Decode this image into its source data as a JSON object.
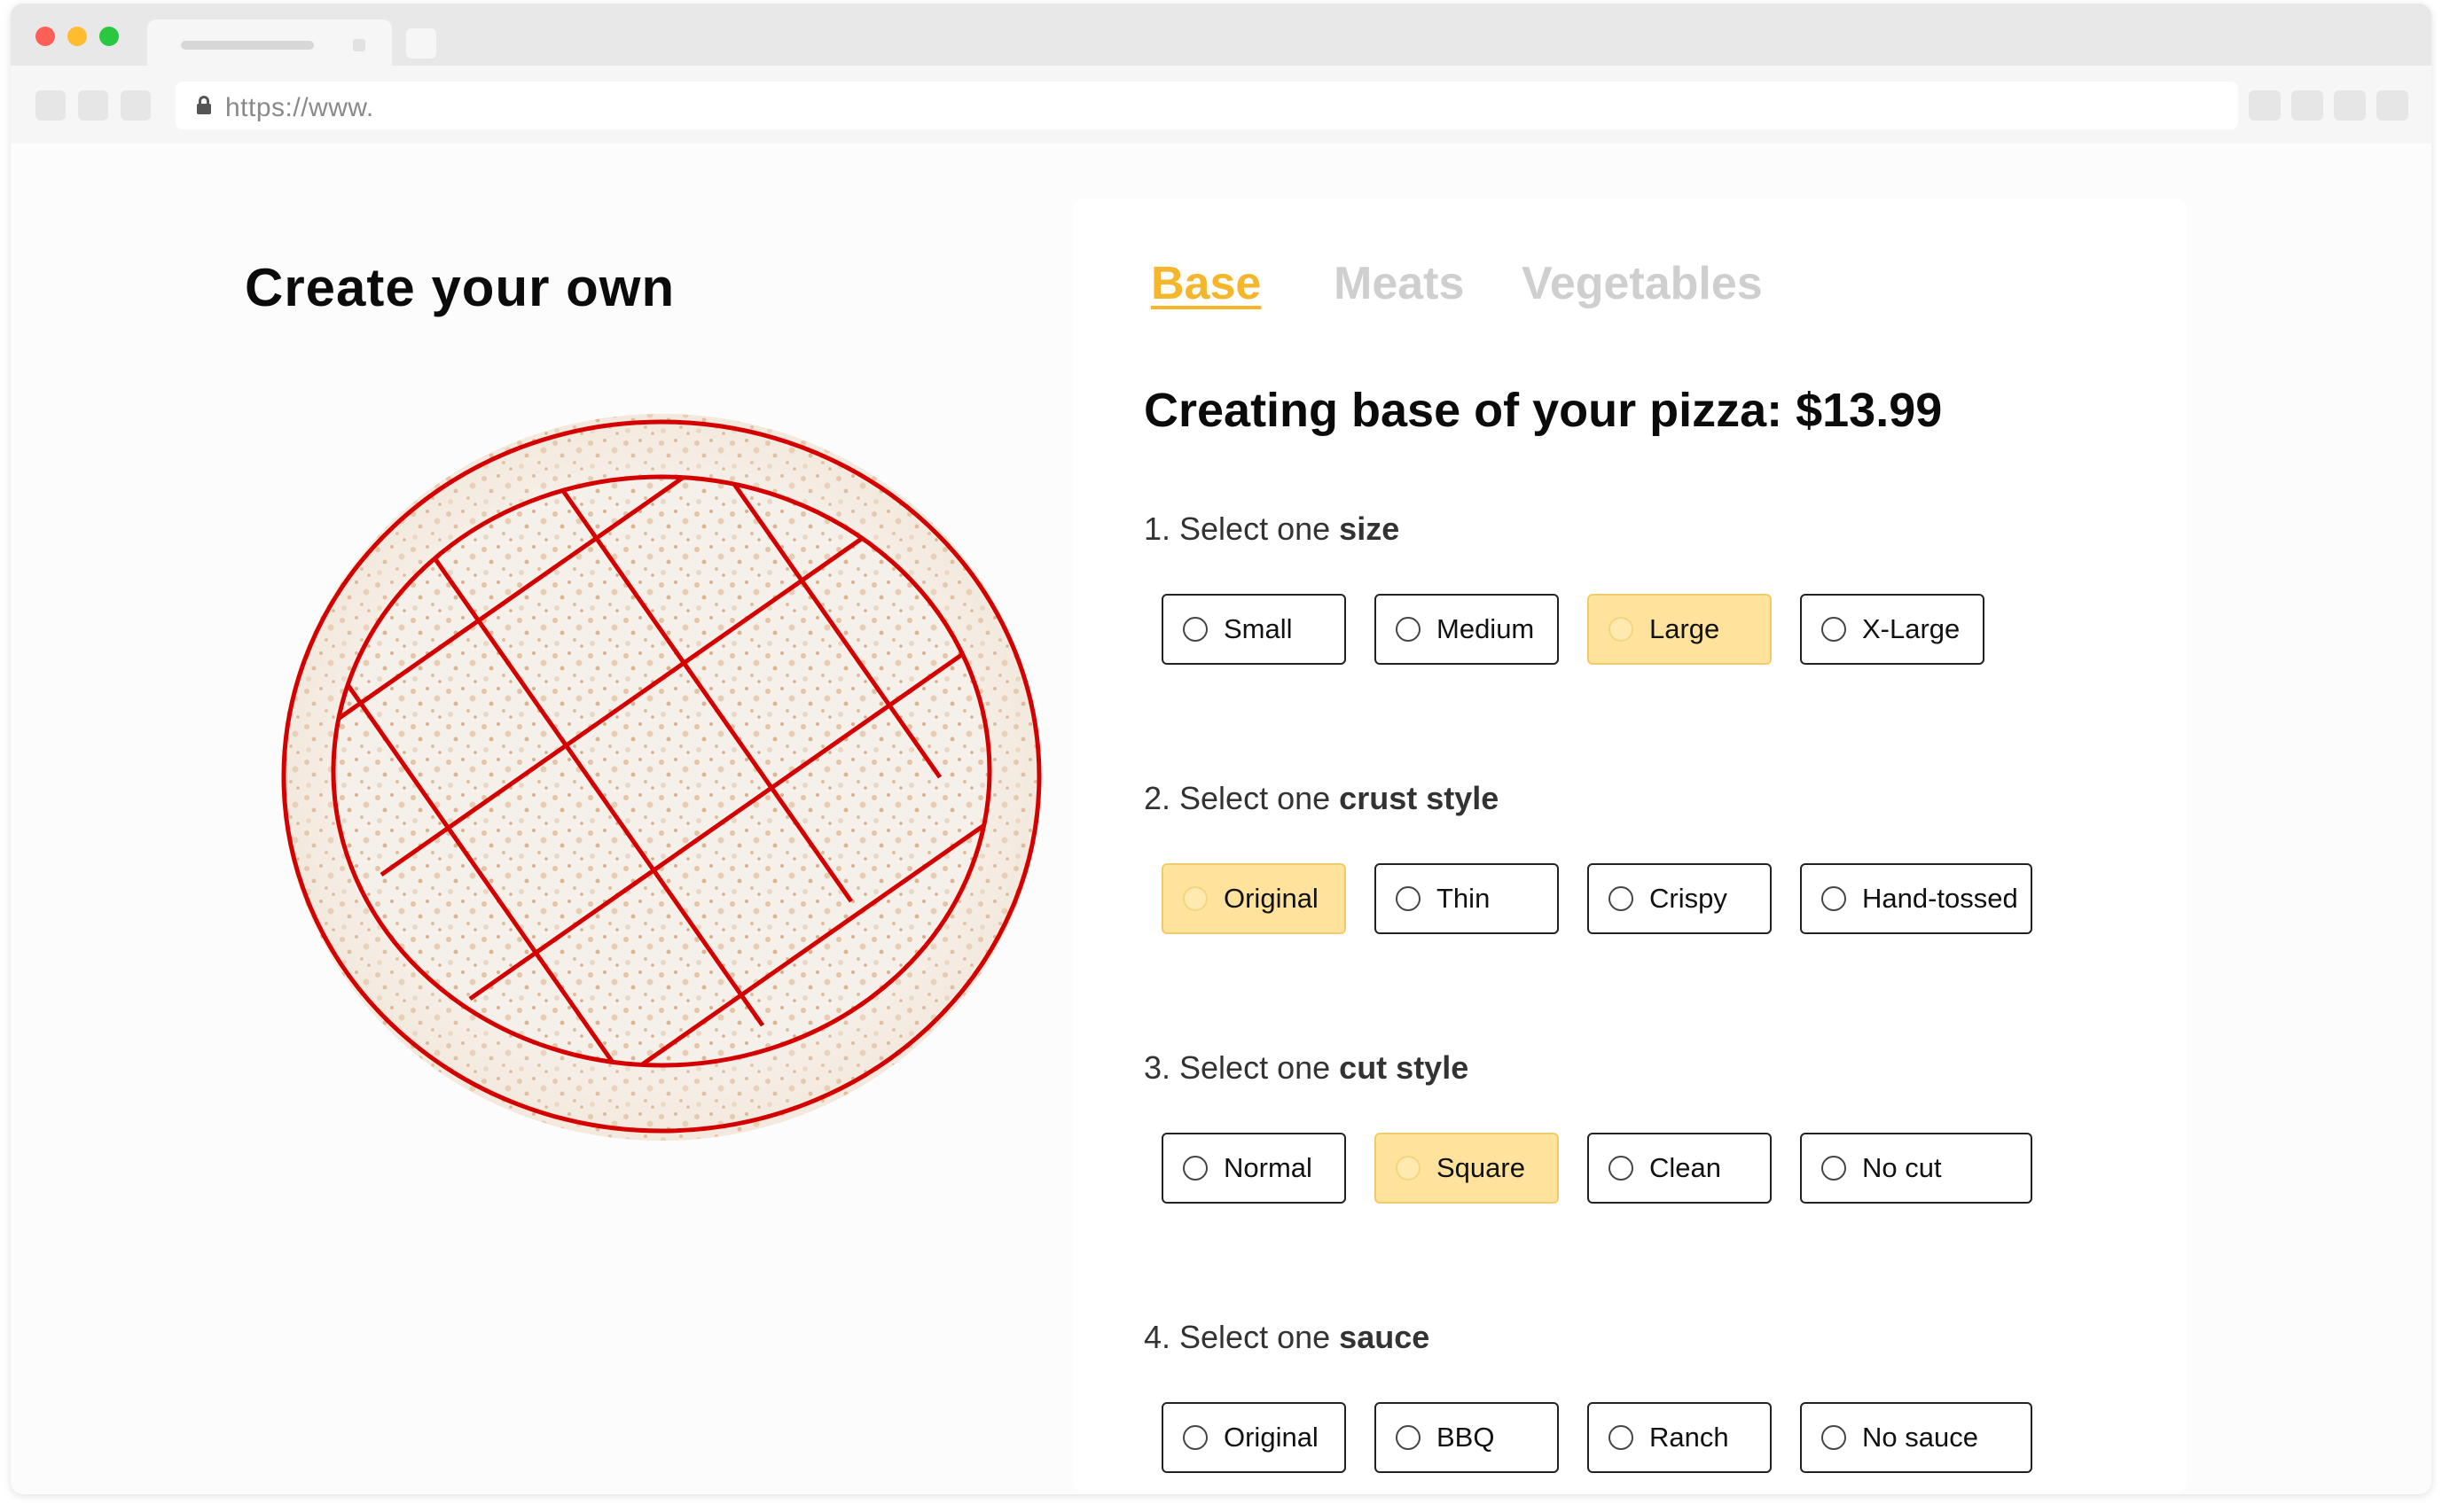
{
  "browser": {
    "url": "https://www."
  },
  "left": {
    "title": "Create your own"
  },
  "tabs": [
    {
      "label": "Base",
      "active": true
    },
    {
      "label": "Meats",
      "active": false
    },
    {
      "label": "Vegetables",
      "active": false
    }
  ],
  "heading": "Creating base of your pizza: $13.99",
  "questions": [
    {
      "prefix": "1. Select one",
      "keyword": "size",
      "options": [
        "Small",
        "Medium",
        "Large",
        "X-Large"
      ],
      "selected": "Large"
    },
    {
      "prefix": "2. Select one",
      "keyword": "crust style",
      "options": [
        "Original",
        "Thin",
        "Crispy",
        "Hand-tossed"
      ],
      "selected": "Original"
    },
    {
      "prefix": "3. Select one",
      "keyword": "cut style",
      "options": [
        "Normal",
        "Square",
        "Clean",
        "No cut"
      ],
      "selected": "Square"
    },
    {
      "prefix": "4. Select one",
      "keyword": "sauce",
      "options": [
        "Original",
        "BBQ",
        "Ranch",
        "No sauce"
      ],
      "selected": null
    }
  ],
  "colors": {
    "accent": "#f6b62c",
    "selected_bg": "#ffe39d",
    "cut_lines": "#d40000"
  }
}
